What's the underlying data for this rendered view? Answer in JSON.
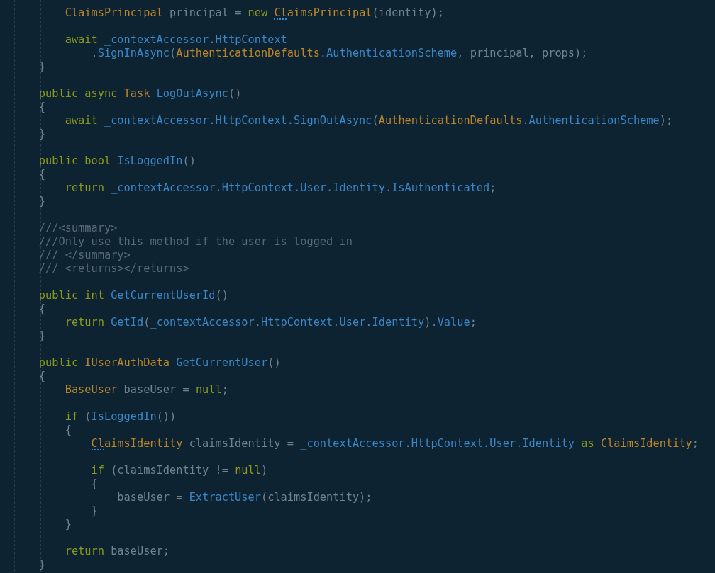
{
  "editor": {
    "lines": [
      {
        "children": [
          {
            "gap_before": false,
            "tokens": [
              {
                "kind": "type",
                "text": "ClaimsPrincipal"
              },
              {
                "kind": "plain",
                "text": " principal = "
              },
              {
                "kind": "keyword",
                "text": "new "
              },
              {
                "kind": "type",
                "text": "ClaimsPrincipal",
                "hint": true
              },
              {
                "kind": "plain",
                "text": "(identity);"
              }
            ]
          },
          {
            "gap_before": true,
            "tokens": [
              {
                "kind": "keyword",
                "text": "await "
              },
              {
                "kind": "member",
                "text": "_contextAccessor.HttpContext"
              }
            ],
            "children": [
              {
                "gap_before": false,
                "tokens": [
                  {
                    "kind": "member",
                    "text": ".SignInAsync"
                  },
                  {
                    "kind": "plain",
                    "text": "("
                  },
                  {
                    "kind": "type",
                    "text": "AuthenticationDefaults"
                  },
                  {
                    "kind": "member",
                    "text": ".AuthenticationScheme"
                  },
                  {
                    "kind": "plain",
                    "text": ", principal, props);"
                  }
                ]
              }
            ]
          }
        ]
      },
      {
        "gap_before": false,
        "tokens": [
          {
            "kind": "plain",
            "text": "}"
          }
        ]
      },
      {
        "gap_before": true,
        "tokens": [
          {
            "kind": "keyword",
            "text": "public async "
          },
          {
            "kind": "type",
            "text": "Task "
          },
          {
            "kind": "member",
            "text": "LogOutAsync"
          },
          {
            "kind": "plain",
            "text": "()"
          }
        ]
      },
      {
        "gap_before": false,
        "tokens": [
          {
            "kind": "plain",
            "text": "{"
          }
        ],
        "children": [
          {
            "gap_before": false,
            "tokens": [
              {
                "kind": "keyword",
                "text": "await "
              },
              {
                "kind": "member",
                "text": "_contextAccessor.HttpContext.SignOutAsync"
              },
              {
                "kind": "plain",
                "text": "("
              },
              {
                "kind": "type",
                "text": "AuthenticationDefaults"
              },
              {
                "kind": "member",
                "text": ".AuthenticationScheme"
              },
              {
                "kind": "plain",
                "text": ");"
              }
            ]
          }
        ]
      },
      {
        "gap_before": false,
        "tokens": [
          {
            "kind": "plain",
            "text": "}"
          }
        ]
      },
      {
        "gap_before": true,
        "tokens": [
          {
            "kind": "keyword",
            "text": "public bool "
          },
          {
            "kind": "member",
            "text": "IsLoggedIn"
          },
          {
            "kind": "plain",
            "text": "()"
          }
        ]
      },
      {
        "gap_before": false,
        "tokens": [
          {
            "kind": "plain",
            "text": "{"
          }
        ],
        "children": [
          {
            "gap_before": false,
            "tokens": [
              {
                "kind": "keyword",
                "text": "return "
              },
              {
                "kind": "member",
                "text": "_contextAccessor.HttpContext.User.Identity.IsAuthenticated"
              },
              {
                "kind": "plain",
                "text": ";"
              }
            ]
          }
        ]
      },
      {
        "gap_before": false,
        "tokens": [
          {
            "kind": "plain",
            "text": "}"
          }
        ]
      },
      {
        "gap_before": true,
        "tokens": [
          {
            "kind": "comment",
            "text": "///<summary>"
          }
        ]
      },
      {
        "gap_before": false,
        "tokens": [
          {
            "kind": "comment",
            "text": "///Only use this method if the user is logged in"
          }
        ]
      },
      {
        "gap_before": false,
        "tokens": [
          {
            "kind": "comment",
            "text": "/// </summary>"
          }
        ]
      },
      {
        "gap_before": false,
        "tokens": [
          {
            "kind": "comment",
            "text": "/// <returns></returns>"
          }
        ]
      },
      {
        "gap_before": true,
        "tokens": [
          {
            "kind": "keyword",
            "text": "public int "
          },
          {
            "kind": "member",
            "text": "GetCurrentUserId"
          },
          {
            "kind": "plain",
            "text": "()"
          }
        ]
      },
      {
        "gap_before": false,
        "tokens": [
          {
            "kind": "plain",
            "text": "{"
          }
        ],
        "children": [
          {
            "gap_before": false,
            "tokens": [
              {
                "kind": "keyword",
                "text": "return "
              },
              {
                "kind": "member",
                "text": "GetId"
              },
              {
                "kind": "plain",
                "text": "("
              },
              {
                "kind": "member",
                "text": "_contextAccessor.HttpContext.User.Identity"
              },
              {
                "kind": "plain",
                "text": ")"
              },
              {
                "kind": "member",
                "text": ".Value"
              },
              {
                "kind": "plain",
                "text": ";"
              }
            ]
          }
        ]
      },
      {
        "gap_before": false,
        "tokens": [
          {
            "kind": "plain",
            "text": "}"
          }
        ]
      },
      {
        "gap_before": true,
        "tokens": [
          {
            "kind": "keyword",
            "text": "public "
          },
          {
            "kind": "type",
            "text": "IUserAuthData "
          },
          {
            "kind": "member",
            "text": "GetCurrentUser"
          },
          {
            "kind": "plain",
            "text": "()"
          }
        ]
      },
      {
        "gap_before": false,
        "tokens": [
          {
            "kind": "plain",
            "text": "{"
          }
        ],
        "children": [
          {
            "gap_before": false,
            "tokens": [
              {
                "kind": "type",
                "text": "BaseUser"
              },
              {
                "kind": "plain",
                "text": " baseUser = "
              },
              {
                "kind": "keyword",
                "text": "null"
              },
              {
                "kind": "plain",
                "text": ";"
              }
            ]
          },
          {
            "gap_before": true,
            "tokens": [
              {
                "kind": "keyword",
                "text": "if"
              },
              {
                "kind": "plain",
                "text": " ("
              },
              {
                "kind": "member",
                "text": "IsLoggedIn"
              },
              {
                "kind": "plain",
                "text": "())"
              }
            ]
          },
          {
            "gap_before": false,
            "tokens": [
              {
                "kind": "plain",
                "text": "{"
              }
            ],
            "children": [
              {
                "gap_before": false,
                "tokens": [
                  {
                    "kind": "type",
                    "text": "ClaimsIdentity",
                    "hint": true
                  },
                  {
                    "kind": "plain",
                    "text": " claimsIdentity = "
                  },
                  {
                    "kind": "member",
                    "text": "_contextAccessor.HttpContext.User.Identity"
                  },
                  {
                    "kind": "keyword",
                    "text": " as "
                  },
                  {
                    "kind": "type",
                    "text": "ClaimsIdentity"
                  },
                  {
                    "kind": "plain",
                    "text": ";"
                  }
                ]
              },
              {
                "gap_before": true,
                "tokens": [
                  {
                    "kind": "keyword",
                    "text": "if"
                  },
                  {
                    "kind": "plain",
                    "text": " (claimsIdentity != "
                  },
                  {
                    "kind": "keyword",
                    "text": "null"
                  },
                  {
                    "kind": "plain",
                    "text": ")"
                  }
                ]
              },
              {
                "gap_before": false,
                "tokens": [
                  {
                    "kind": "plain",
                    "text": "{"
                  }
                ],
                "children": [
                  {
                    "gap_before": false,
                    "tokens": [
                      {
                        "kind": "plain",
                        "text": "baseUser = "
                      },
                      {
                        "kind": "member",
                        "text": "ExtractUser"
                      },
                      {
                        "kind": "plain",
                        "text": "(claimsIdentity);"
                      }
                    ]
                  }
                ]
              },
              {
                "gap_before": false,
                "tokens": [
                  {
                    "kind": "plain",
                    "text": "}"
                  }
                ]
              }
            ]
          },
          {
            "gap_before": false,
            "tokens": [
              {
                "kind": "plain",
                "text": "}"
              }
            ]
          },
          {
            "gap_before": true,
            "tokens": [
              {
                "kind": "keyword",
                "text": "return"
              },
              {
                "kind": "plain",
                "text": " baseUser;"
              }
            ]
          }
        ]
      },
      {
        "gap_before": false,
        "tokens": [
          {
            "kind": "plain",
            "text": "}"
          }
        ]
      }
    ]
  }
}
